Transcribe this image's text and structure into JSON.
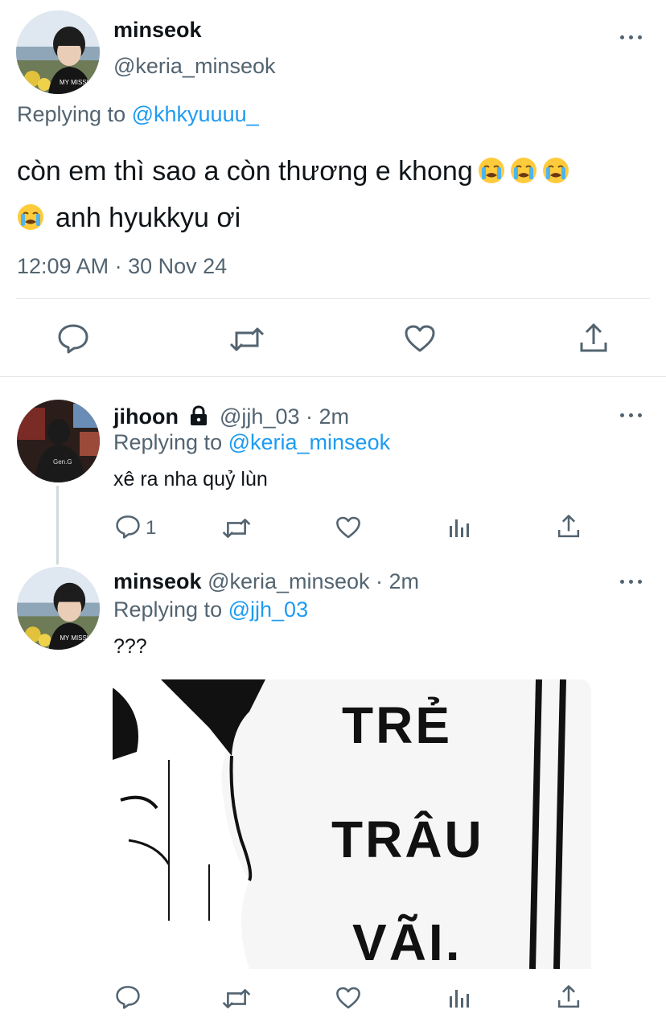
{
  "main_tweet": {
    "display_name": "minseok",
    "handle": "@keria_minseok",
    "replying_prefix": "Replying to",
    "replying_handle": "@khkyuuuu_",
    "text_line1": "còn em thì sao a còn thương e khong",
    "text_line2": "anh hyukkyu ơi",
    "emoji_name": "loudly-crying-face",
    "timestamp": "12:09 AM · 30 Nov 24"
  },
  "reply1": {
    "display_name": "jihoon",
    "handle_time": "@jjh_03 · 2m",
    "replying_prefix": "Replying to",
    "replying_handle": "@keria_minseok",
    "text": "xê ra nha quỷ lùn",
    "reply_count": "1"
  },
  "reply2": {
    "display_name": "minseok",
    "handle_time": "@keria_minseok · 2m",
    "replying_prefix": "Replying to",
    "replying_handle": "@jjh_03",
    "text": "???",
    "image_text_lines": [
      "TRẺ",
      "TRÂU",
      "VÃI."
    ]
  },
  "colors": {
    "accent": "#1d9bf0",
    "secondary_text": "#536471",
    "divider": "#e1e5e8"
  }
}
